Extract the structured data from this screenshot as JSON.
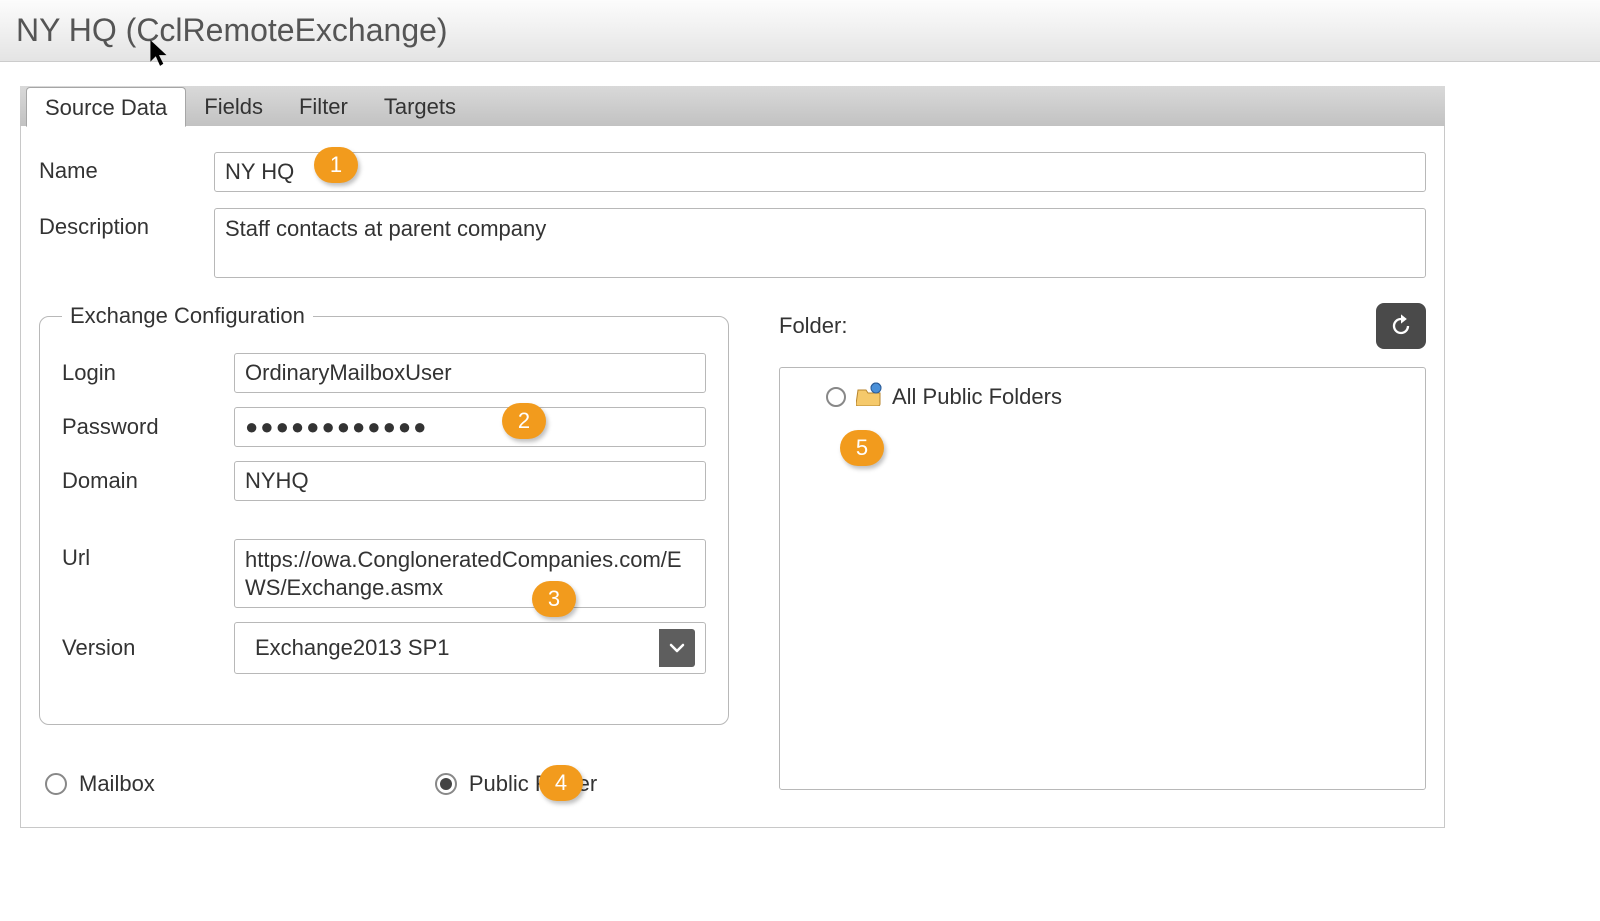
{
  "window": {
    "title": "NY HQ (CclRemoteExchange)"
  },
  "tabs": [
    {
      "label": "Source Data",
      "active": true
    },
    {
      "label": "Fields",
      "active": false
    },
    {
      "label": "Filter",
      "active": false
    },
    {
      "label": "Targets",
      "active": false
    }
  ],
  "form": {
    "name_label": "Name",
    "name_value": "NY HQ",
    "description_label": "Description",
    "description_value": "Staff contacts at parent company"
  },
  "exchange": {
    "legend": "Exchange Configuration",
    "login_label": "Login",
    "login_value": "OrdinaryMailboxUser",
    "password_label": "Password",
    "password_display": "●●●●●●●●●●●●",
    "domain_label": "Domain",
    "domain_value": "NYHQ",
    "url_label": "Url",
    "url_value": "https://owa.CongloneratedCompanies.com/EWS/Exchange.asmx",
    "version_label": "Version",
    "version_value": "Exchange2013 SP1"
  },
  "folder": {
    "title": "Folder:",
    "options": {
      "mailbox_label": "Mailbox",
      "public_folder_label": "Public Folder",
      "selected": "public_folder"
    },
    "tree_root_label": "All Public Folders"
  },
  "callouts": {
    "c1": "1",
    "c2": "2",
    "c3": "3",
    "c4": "4",
    "c5": "5"
  }
}
